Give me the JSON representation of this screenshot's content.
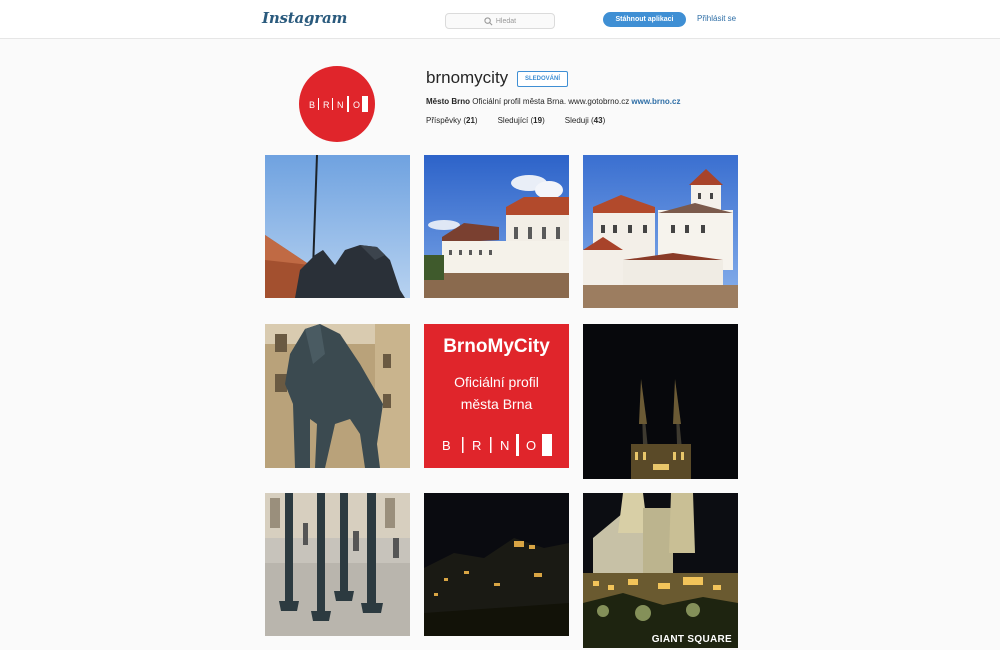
{
  "header": {
    "logo": "Instagram",
    "search_placeholder": "Hledat",
    "download_label": "Stáhnout aplikaci",
    "login_label": "Přihlásit se"
  },
  "profile": {
    "username": "brnomycity",
    "follow_label": "SLEDOVÁNÍ",
    "full_name": "Město Brno",
    "bio_text": "Oficiální profil města Brna. www.gotobrno.cz",
    "bio_link": "www.brno.cz",
    "avatar_letters": [
      "B",
      "R",
      "N",
      "O"
    ],
    "stats": [
      {
        "label": "Příspěvky",
        "count": "21"
      },
      {
        "label": "Sledující",
        "count": "19"
      },
      {
        "label": "Sleduji",
        "count": "43"
      }
    ]
  },
  "posts": {
    "promo": {
      "title": "BrnoMyCity",
      "line1": "Oficiální profil",
      "line2": "města Brna",
      "letters": [
        "B",
        "R",
        "N",
        "O"
      ]
    },
    "giant_square_label": "GIANT SQUARE"
  },
  "colors": {
    "brand_red": "#e0252b",
    "accent_blue": "#3f8fd4",
    "link_blue": "#2e6ea6"
  }
}
